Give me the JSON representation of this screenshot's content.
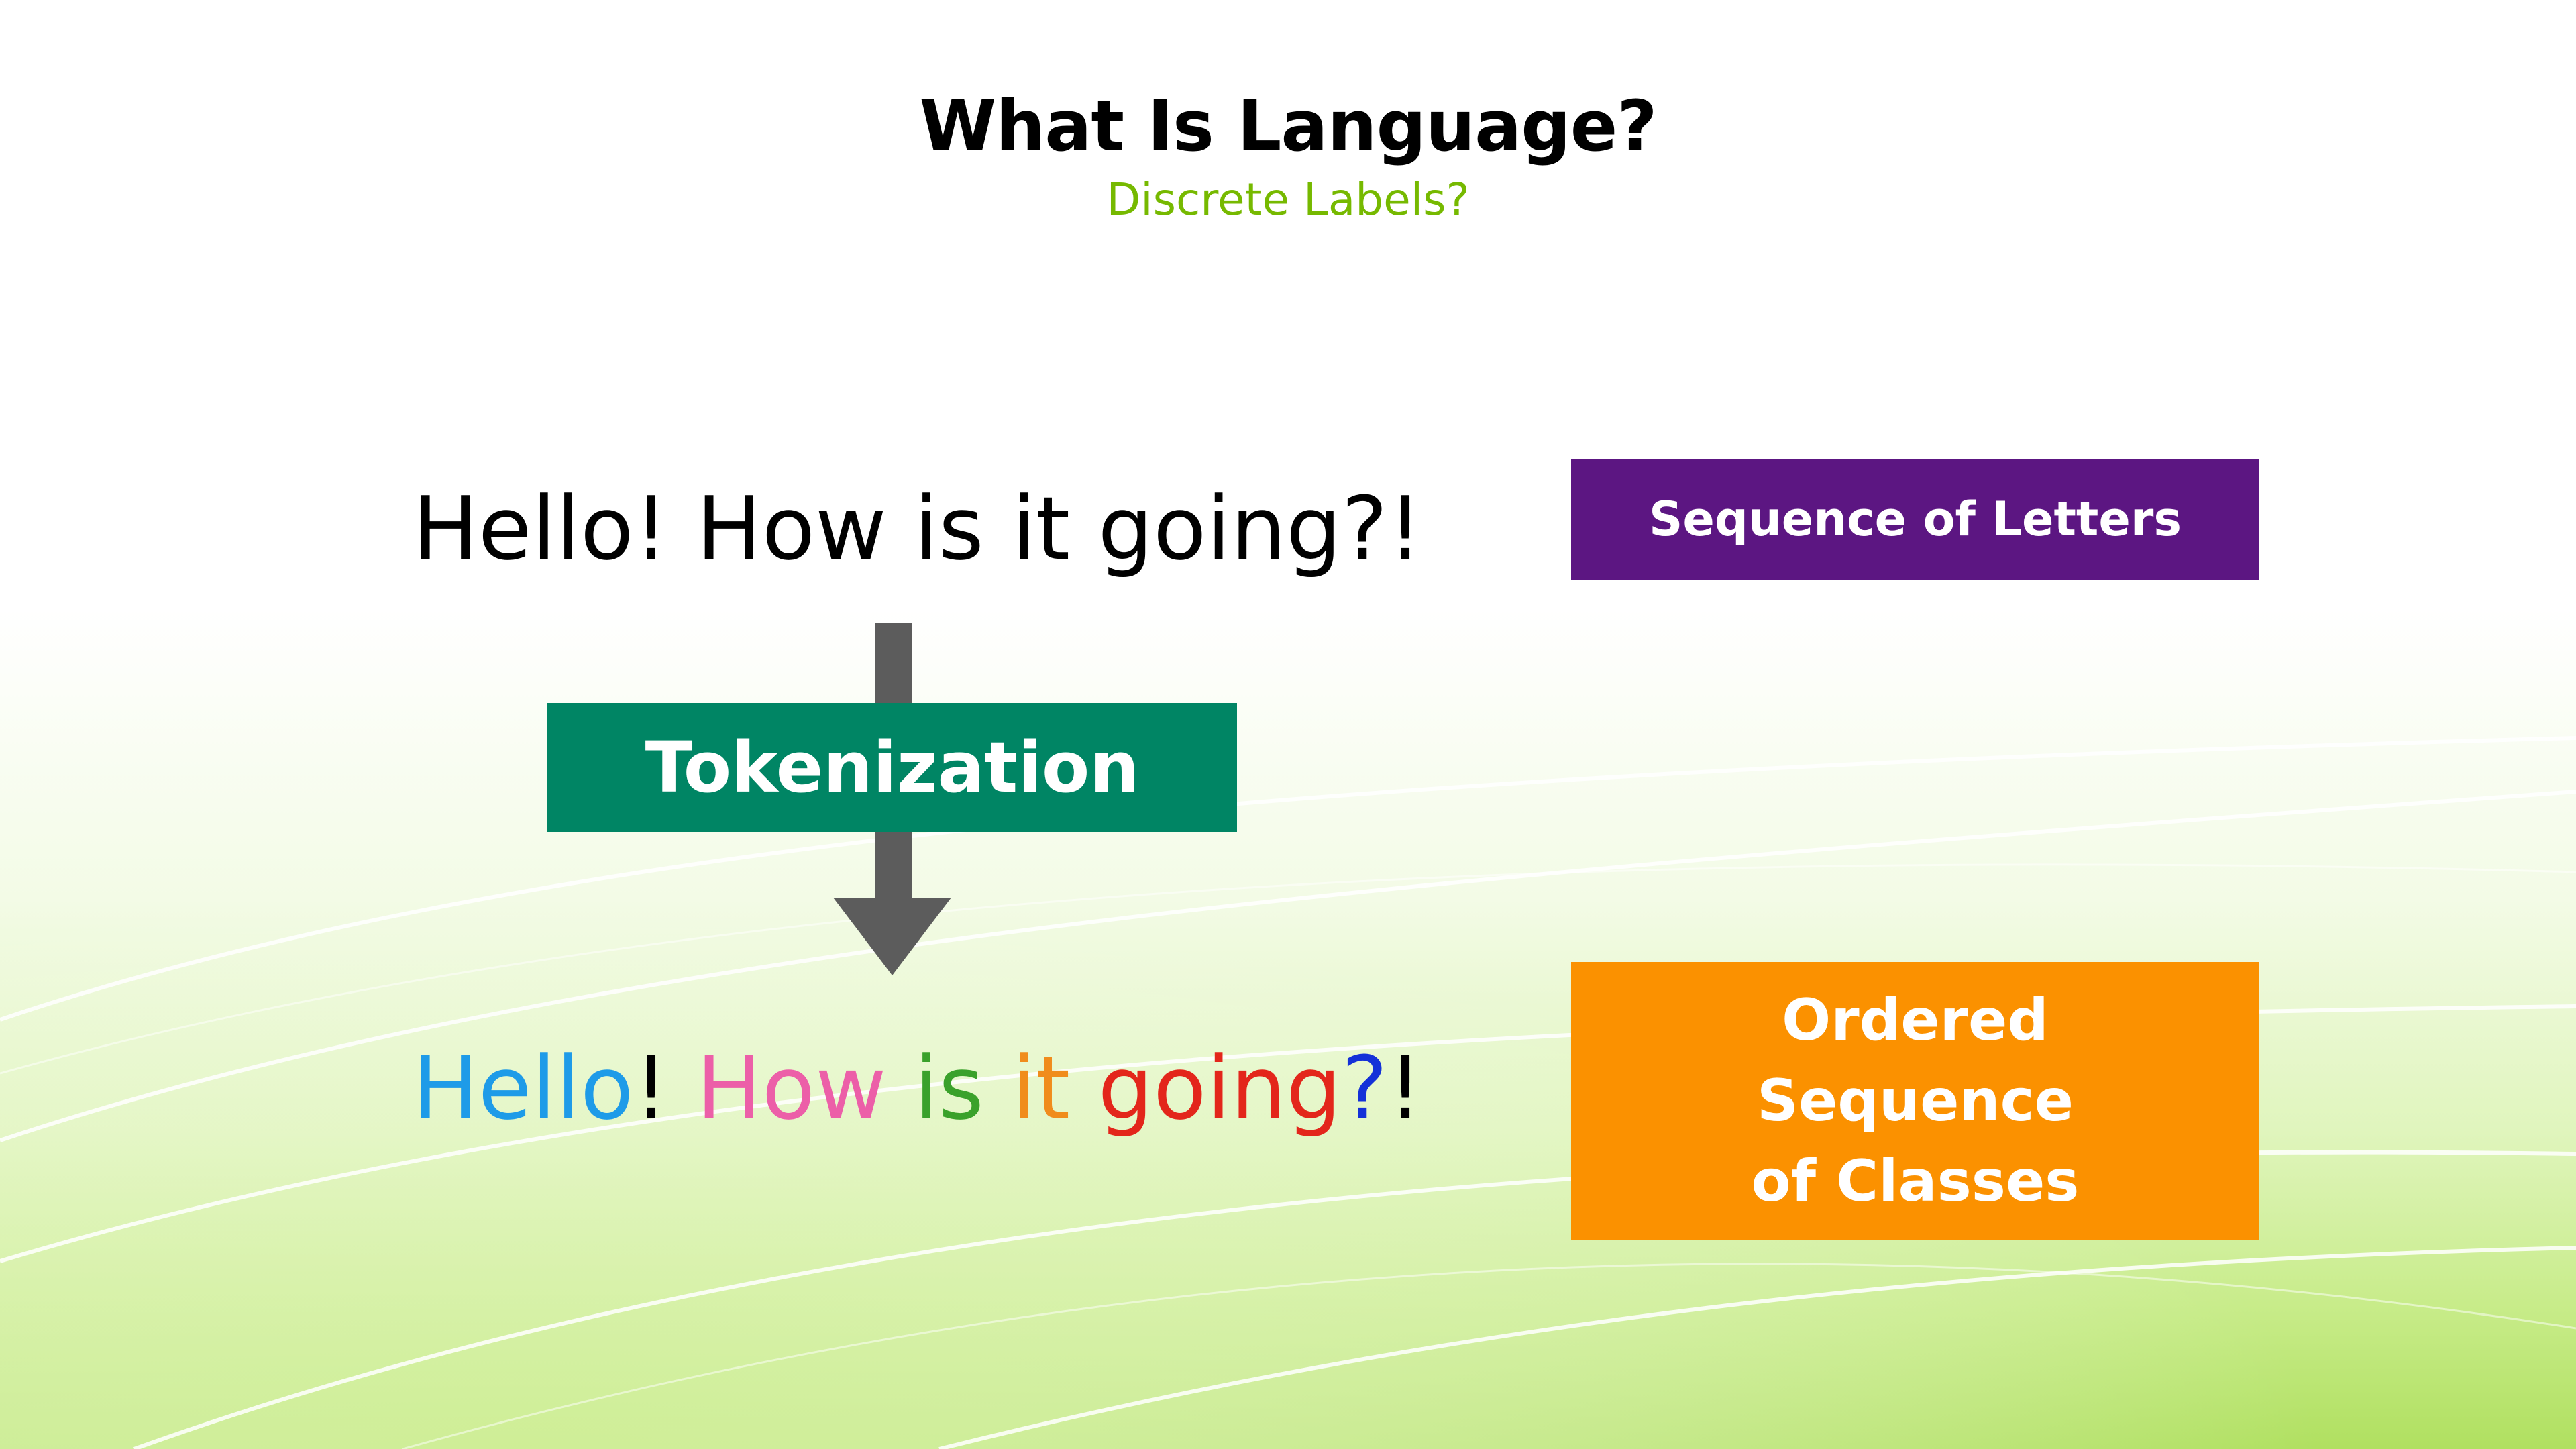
{
  "slide": {
    "title": "What Is Language?",
    "subtitle": "Discrete Labels?",
    "plain_sentence": "Hello! How is it going?!",
    "tokens": [
      {
        "text": "Hello",
        "color": "#1e9be8"
      },
      {
        "text": "! ",
        "color": "#000000"
      },
      {
        "text": "How ",
        "color": "#ec5fa8"
      },
      {
        "text": "is ",
        "color": "#3aa12b"
      },
      {
        "text": "it ",
        "color": "#f08c1c"
      },
      {
        "text": "going",
        "color": "#e3261b"
      },
      {
        "text": "?",
        "color": "#1431d8"
      },
      {
        "text": "!",
        "color": "#000000"
      }
    ],
    "tokenization_label": "Tokenization",
    "letters_label": "Sequence of Letters",
    "classes_label_lines": [
      "Ordered",
      "Sequence",
      "of Classes"
    ]
  },
  "colors": {
    "accent_green": "#76b900",
    "tokenization_box": "#008564",
    "letters_box": "#5c1682",
    "classes_box": "#fb9100",
    "arrow": "#5c5c5c"
  },
  "icons": {
    "arrow": "down-arrow-icon"
  }
}
